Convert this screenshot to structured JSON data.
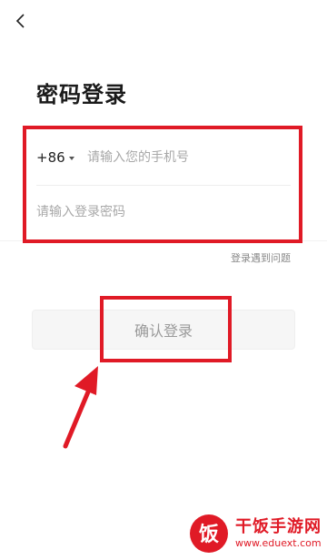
{
  "header": {
    "back_icon": "chevron-left-icon"
  },
  "page": {
    "title": "密码登录"
  },
  "phone": {
    "country_code": "+86",
    "dropdown_icon": "caret-down-icon",
    "placeholder": "请输入您的手机号",
    "value": ""
  },
  "password": {
    "placeholder": "请输入登录密码",
    "value": ""
  },
  "help_link": "登录遇到问题",
  "submit": {
    "label": "确认登录"
  },
  "annotations": {
    "highlight_color": "#e01a26",
    "arrow_icon": "red-arrow-up-icon"
  },
  "watermark": {
    "logo_char": "饭",
    "title": "干饭手游网",
    "url": "www.eduext.com"
  },
  "colors": {
    "accent_red": "#e01a26",
    "button_bg": "#f6f6f6",
    "placeholder": "#a8a8a8"
  }
}
